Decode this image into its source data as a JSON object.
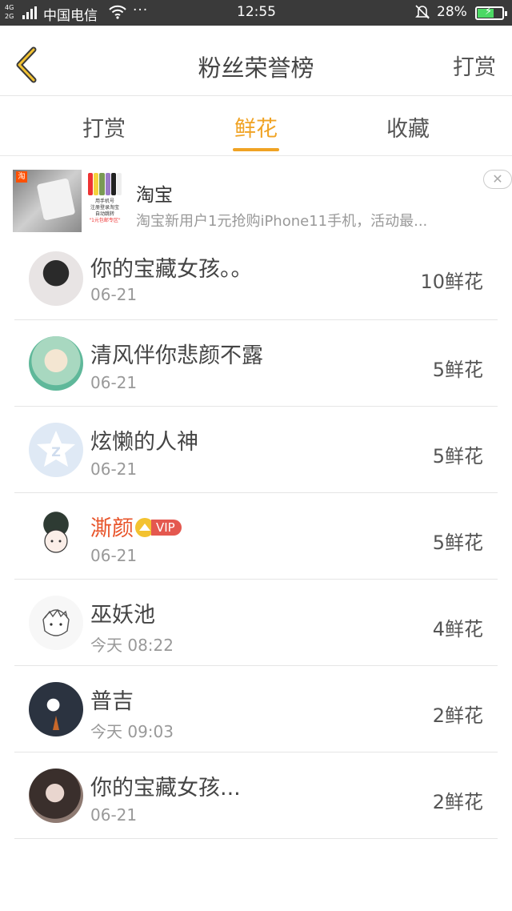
{
  "status_bar": {
    "network": "4G",
    "network2": "2G",
    "carrier": "中国电信",
    "more": "···",
    "time": "12:55",
    "battery_percent": "28%",
    "battery_level": 0.28
  },
  "header": {
    "title": "粉丝荣誉榜",
    "reward_label": "打赏"
  },
  "tabs": [
    {
      "label": "打赏",
      "active": false
    },
    {
      "label": "鲜花",
      "active": true
    },
    {
      "label": "收藏",
      "active": false
    }
  ],
  "ad": {
    "app_name": "淘宝",
    "description": "淘宝新用户1元抢购iPhone11手机，活动最...",
    "close_label": "✕",
    "badge": "淘",
    "image_text_1": "用手机号",
    "image_text_2": "注册登录淘宝",
    "image_text_3": "自动跳转",
    "image_text_4": "\"1元包邮专区\""
  },
  "fans": [
    {
      "name": "你的宝藏女孩。。",
      "date": "06-21",
      "count": "10鲜花",
      "vip": false
    },
    {
      "name": "清风伴你悲颜不露",
      "date": "06-21",
      "count": "5鲜花",
      "vip": false
    },
    {
      "name": "炫懒的人神",
      "date": "06-21",
      "count": "5鲜花",
      "vip": false
    },
    {
      "name": "澌颜",
      "date": "06-21",
      "count": "5鲜花",
      "vip": true,
      "vip_label": "VIP"
    },
    {
      "name": "巫妖池",
      "date": "今天 08:22",
      "count": "4鲜花",
      "vip": false
    },
    {
      "name": "普吉",
      "date": "今天 09:03",
      "count": "2鲜花",
      "vip": false
    },
    {
      "name": "你的宝藏女孩...",
      "date": "06-21",
      "count": "2鲜花",
      "vip": false
    }
  ],
  "colors": {
    "accent": "#f0a324",
    "vip_name": "#e8542a",
    "status_bar": "#3a3a3a"
  }
}
